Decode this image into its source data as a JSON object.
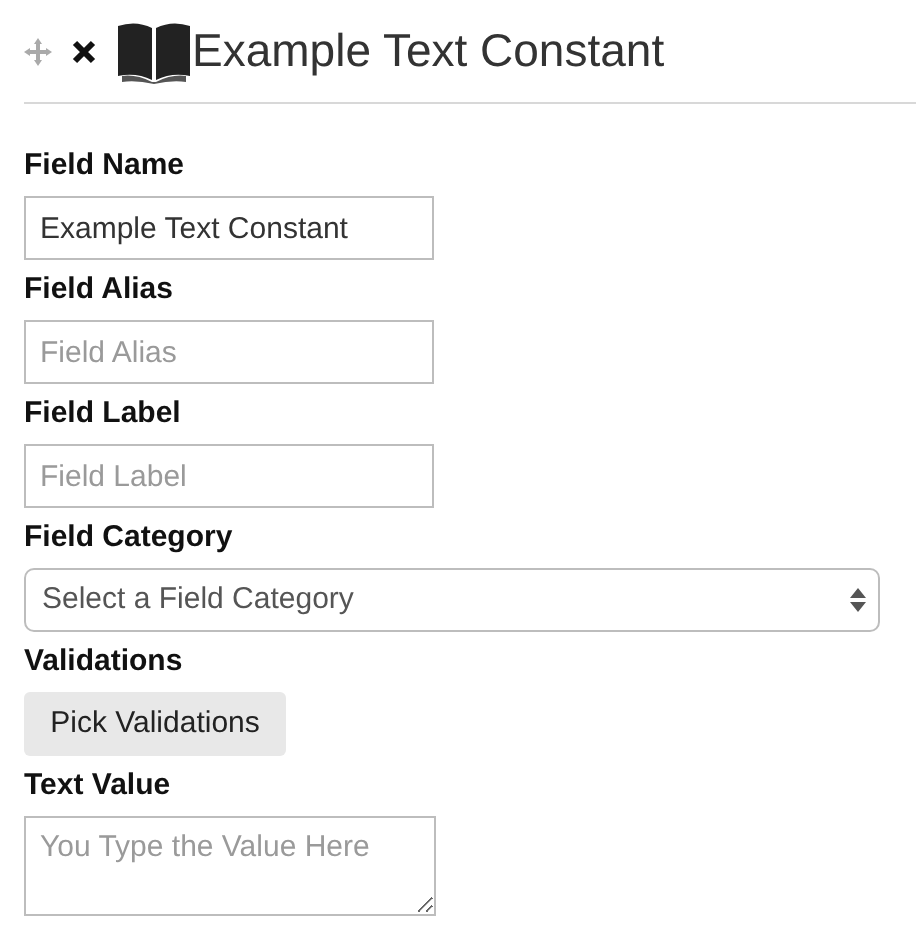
{
  "header": {
    "title": "Example Text Constant"
  },
  "fields": [
    {
      "kind": "text",
      "label": "Field Name",
      "value": "Example Text Constant"
    },
    {
      "kind": "text",
      "label": "Field Alias",
      "placeholder": "Field Alias"
    },
    {
      "kind": "text",
      "label": "Field Label",
      "placeholder": "Field Label"
    },
    {
      "kind": "select",
      "label": "Field Category",
      "placeholder": "Select a Field Category"
    },
    {
      "kind": "button",
      "label": "Validations",
      "button": "Pick Validations"
    },
    {
      "kind": "textarea",
      "label": "Text Value",
      "placeholder": "You Type the Value Here"
    }
  ]
}
